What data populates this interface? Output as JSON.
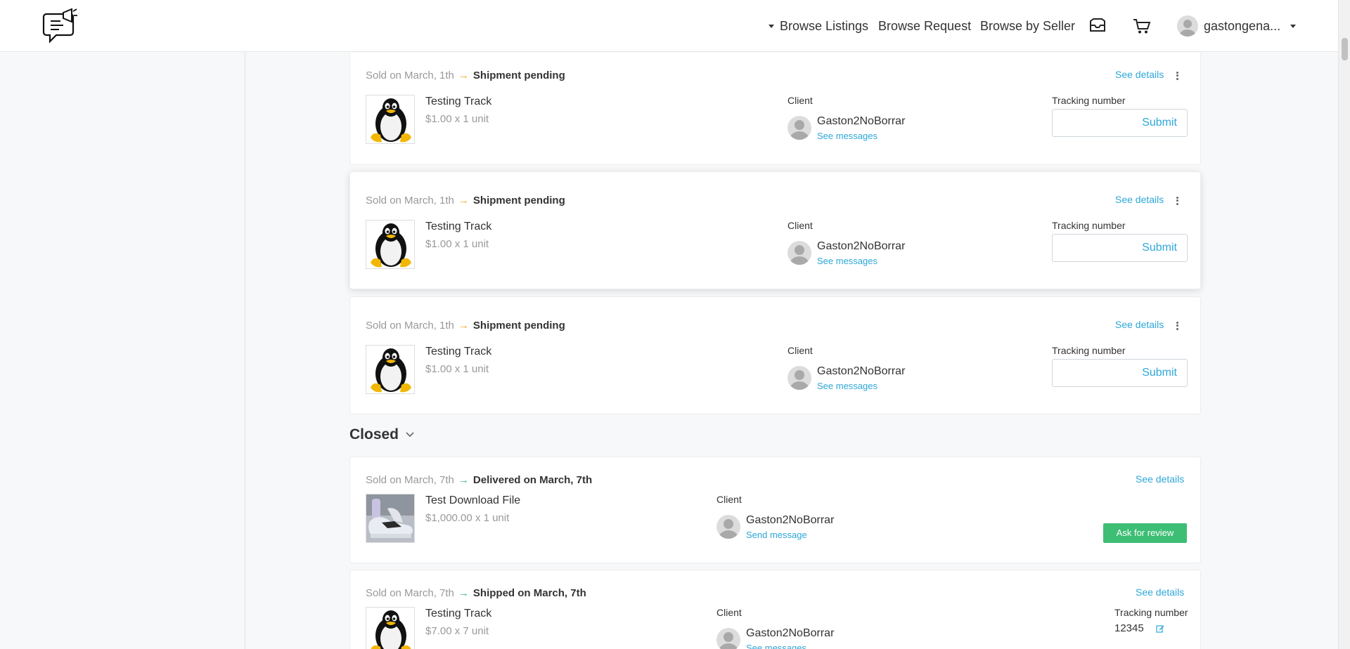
{
  "header": {
    "nav": {
      "browse_listings": "Browse Listings",
      "browse_request": "Browse Request",
      "browse_by_seller": "Browse by Seller"
    },
    "username": "gastongena...",
    "icons": [
      "logo-icon",
      "inbox-icon",
      "cart-icon",
      "avatar"
    ]
  },
  "labels": {
    "see_details": "See details",
    "client": "Client",
    "tracking_number": "Tracking number",
    "submit": "Submit",
    "see_messages": "See messages",
    "send_message": "Send message",
    "ask_for_review": "Ask for review",
    "arrow": "→"
  },
  "open_orders": [
    {
      "sold": "Sold on March, 1th",
      "status": "Shipment pending",
      "product": "Testing Track",
      "price": "$1.00 x 1 unit",
      "client": "Gaston2NoBorrar",
      "tracking": ""
    },
    {
      "sold": "Sold on March, 1th",
      "status": "Shipment pending",
      "product": "Testing Track",
      "price": "$1.00 x 1 unit",
      "client": "Gaston2NoBorrar",
      "tracking": ""
    },
    {
      "sold": "Sold on March, 1th",
      "status": "Shipment pending",
      "product": "Testing Track",
      "price": "$1.00 x 1 unit",
      "client": "Gaston2NoBorrar",
      "tracking": ""
    }
  ],
  "closed_section": {
    "title": "Closed",
    "orders": [
      {
        "sold": "Sold on March, 7th",
        "status": "Delivered on March, 7th",
        "product": "Test Download File",
        "price": "$1,000.00 x 1 unit",
        "client": "Gaston2NoBorrar"
      },
      {
        "sold": "Sold on March, 7th",
        "status": "Shipped on March, 7th",
        "product": "Testing Track",
        "price": "$7.00 x 7 unit",
        "client": "Gaston2NoBorrar",
        "tracking_value": "12345"
      }
    ]
  },
  "colors": {
    "link": "#2ea7d8",
    "pending_arrow": "#f5a623",
    "closed_arrow": "#3dbe74",
    "review_button": "#3dbe74"
  }
}
